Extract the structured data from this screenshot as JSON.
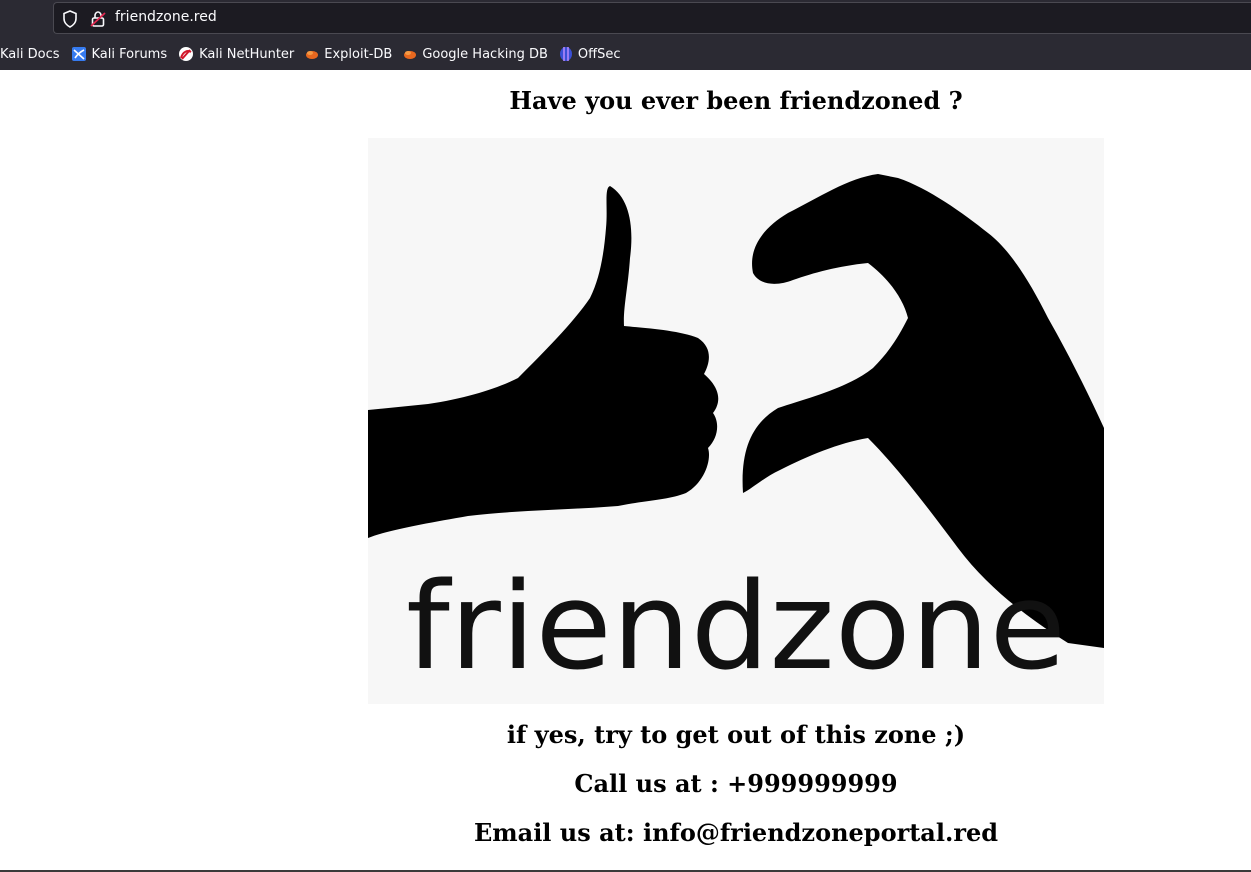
{
  "browser": {
    "url": "friendzone.red",
    "bookmarks": [
      {
        "label": "Kali Docs",
        "icon": "none"
      },
      {
        "label": "Kali Forums",
        "icon": "kali-forums-icon"
      },
      {
        "label": "Kali NetHunter",
        "icon": "kali-nethunter-icon"
      },
      {
        "label": "Exploit-DB",
        "icon": "exploit-db-icon"
      },
      {
        "label": "Google Hacking DB",
        "icon": "exploit-db-icon"
      },
      {
        "label": "OffSec",
        "icon": "offsec-icon"
      }
    ]
  },
  "page": {
    "heading": "Have you ever been friendzoned ?",
    "image_wordmark": "friendzone",
    "line1": "if yes, try to get out of this zone ;)",
    "line2": "Call us at : +999999999",
    "line3": "Email us at: info@friendzoneportal.red"
  }
}
